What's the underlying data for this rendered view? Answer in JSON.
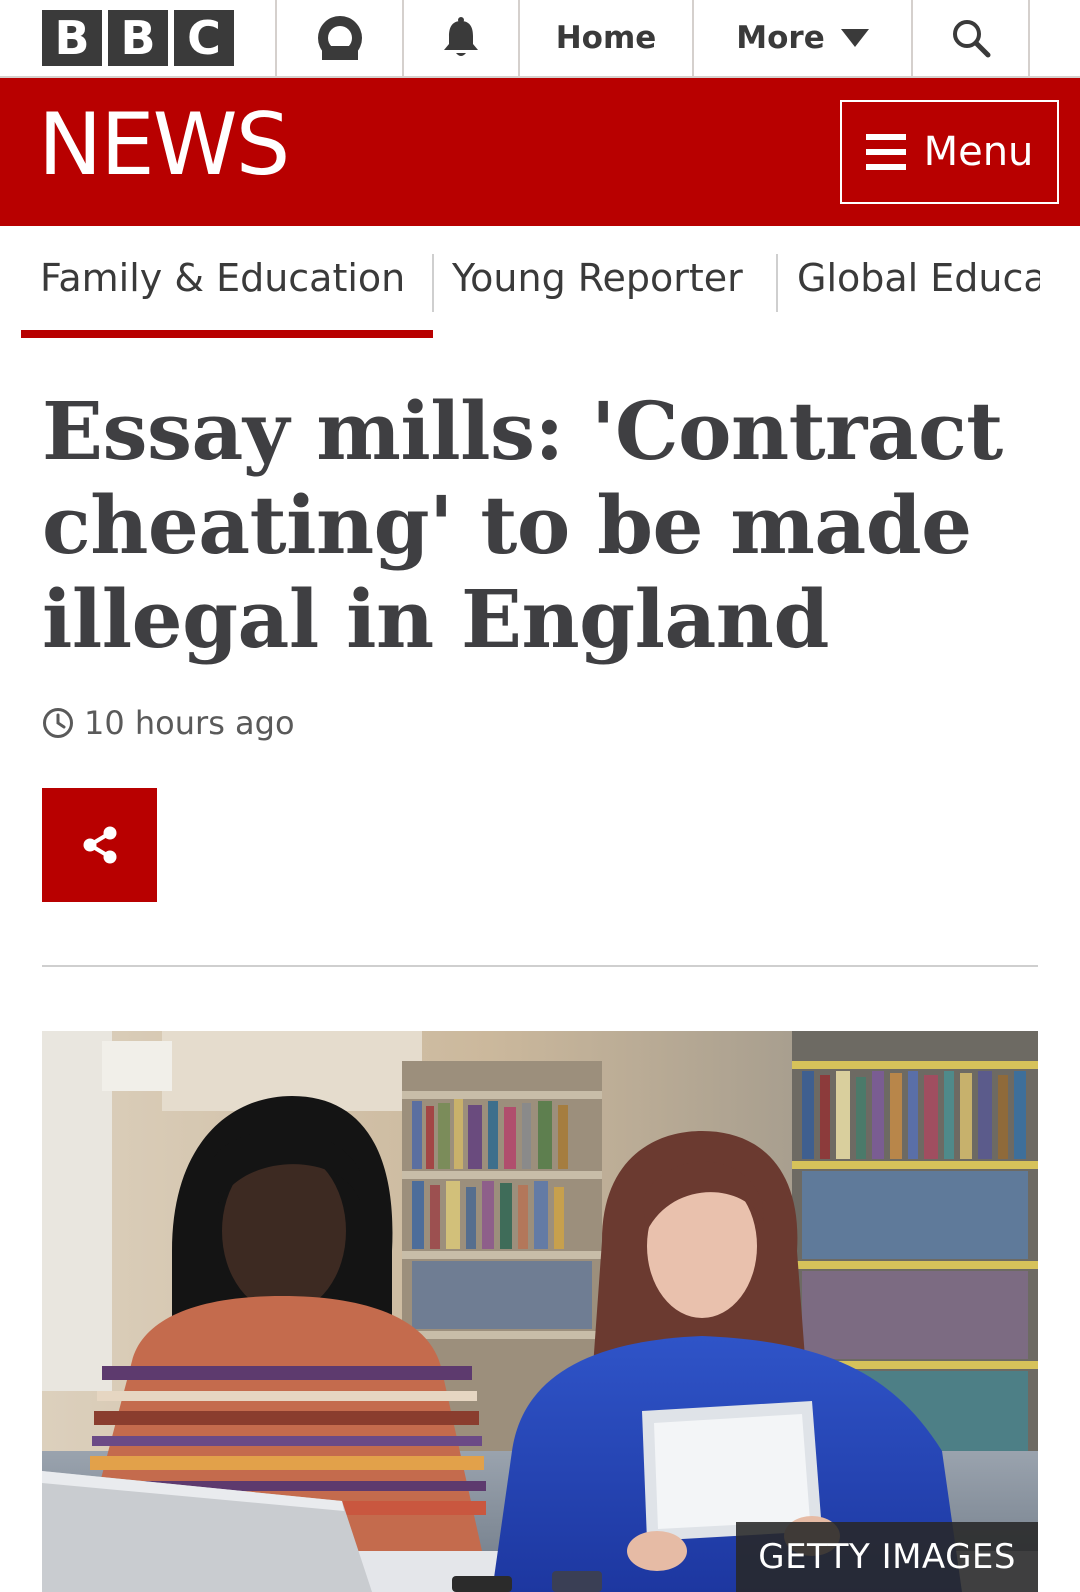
{
  "brand": {
    "letters": [
      "B",
      "B",
      "C"
    ]
  },
  "topnav": {
    "account_icon": "user-icon",
    "notifications_icon": "bell-icon",
    "home_label": "Home",
    "more_label": "More",
    "search_icon": "search-icon"
  },
  "banner": {
    "title": "NEWS",
    "menu_label": "Menu",
    "color": "#b80000"
  },
  "sections": [
    {
      "label": "Family & Education",
      "active": true
    },
    {
      "label": "Young Reporter",
      "active": false
    },
    {
      "label": "Global Educa",
      "active": false
    }
  ],
  "article": {
    "headline": "Essay mills: 'Contract cheating' to be made illegal in England",
    "timestamp": "10 hours ago",
    "share_icon": "share-icon",
    "image_caption": "GETTY IMAGES"
  }
}
